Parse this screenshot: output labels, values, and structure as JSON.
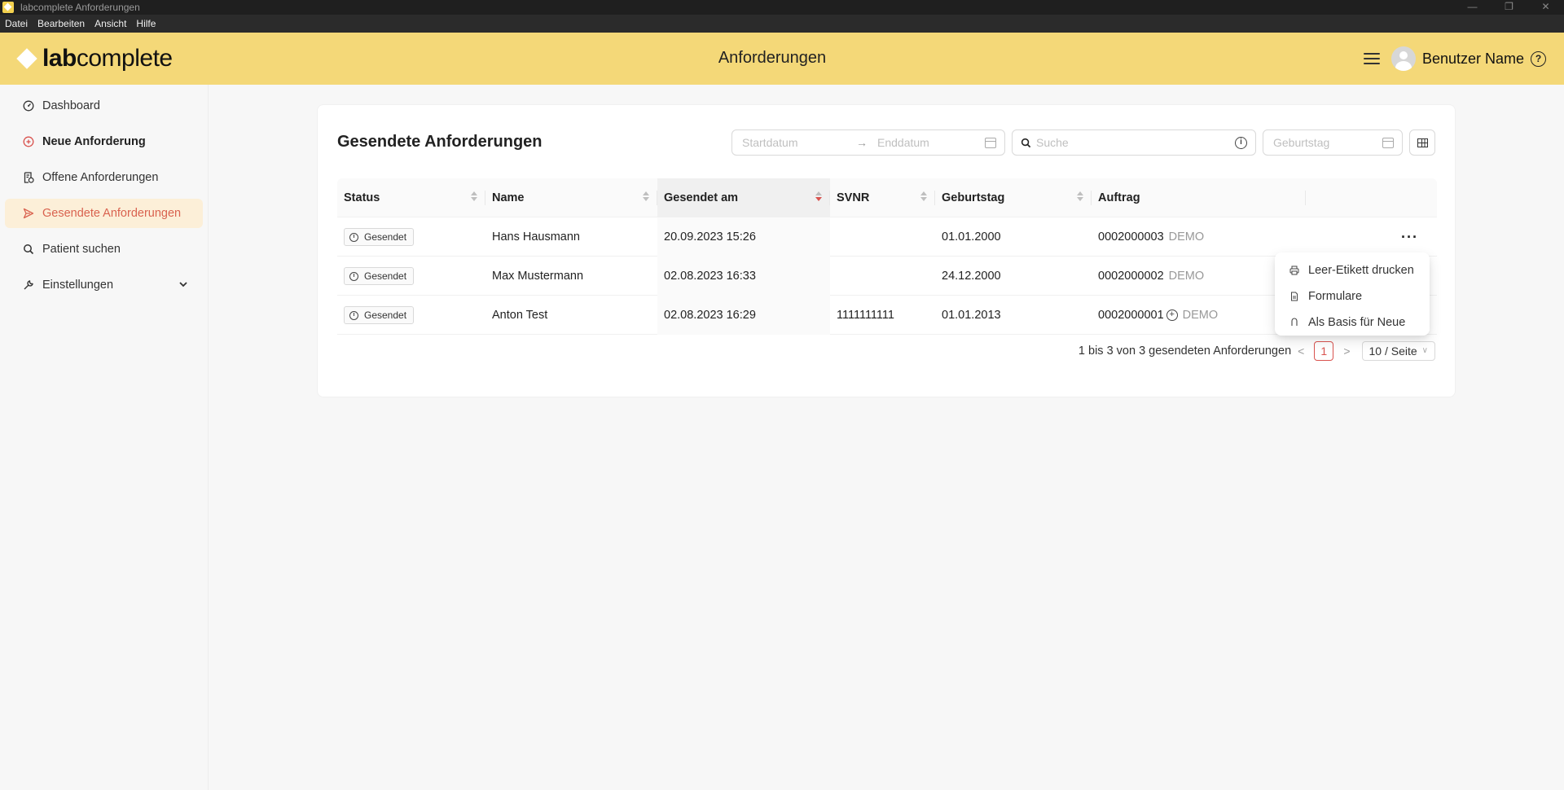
{
  "window": {
    "title": "labcomplete Anforderungen",
    "controls": [
      "—",
      "❐",
      "✕"
    ]
  },
  "menubar": [
    "Datei",
    "Bearbeiten",
    "Ansicht",
    "Hilfe"
  ],
  "header": {
    "logo_bold": "lab",
    "logo_regular": "complete",
    "title": "Anforderungen",
    "user_name": "Benutzer Name",
    "help": "?",
    "accent_color": "#f4d878"
  },
  "sidebar": {
    "items": [
      {
        "label": "Dashboard",
        "icon": "dashboard-icon"
      },
      {
        "label": "Neue Anforderung",
        "icon": "plus-circle-icon"
      },
      {
        "label": "Offene Anforderungen",
        "icon": "document-clock-icon"
      },
      {
        "label": "Gesendete Anforderungen",
        "icon": "send-icon"
      },
      {
        "label": "Patient suchen",
        "icon": "search-icon"
      },
      {
        "label": "Einstellungen",
        "icon": "wrench-icon"
      }
    ],
    "active_color": "#d9624f"
  },
  "card": {
    "title": "Gesendete Anforderungen"
  },
  "filters": {
    "start_placeholder": "Startdatum",
    "end_placeholder": "Enddatum",
    "search_placeholder": "Suche",
    "birthday_placeholder": "Geburtstag"
  },
  "table": {
    "columns": [
      "Status",
      "Name",
      "Gesendet am",
      "SVNR",
      "Geburtstag",
      "Auftrag"
    ],
    "rows": [
      {
        "status": "Gesendet",
        "name": "Hans Hausmann",
        "sent": "20.09.2023 15:26",
        "svnr": "",
        "birthday": "01.01.2000",
        "order": "0002000003",
        "tag": "DEMO"
      },
      {
        "status": "Gesendet",
        "name": "Max Mustermann",
        "sent": "02.08.2023 16:33",
        "svnr": "",
        "birthday": "24.12.2000",
        "order": "0002000002",
        "tag": "DEMO"
      },
      {
        "status": "Gesendet",
        "name": "Anton Test",
        "sent": "02.08.2023 16:29",
        "svnr": "1111111111",
        "birthday": "01.01.2013",
        "order": "0002000001",
        "tag": "DEMO"
      }
    ],
    "more": "···"
  },
  "pagination": {
    "summary": "1 bis 3 von 3 gesendeten Anforderungen",
    "prev": "<",
    "current": "1",
    "next": ">",
    "page_size": "10 / Seite"
  },
  "row_menu": {
    "items": [
      {
        "label": "Leer-Etikett drucken",
        "icon": "printer-icon"
      },
      {
        "label": "Formulare",
        "icon": "file-icon"
      },
      {
        "label": "Als Basis für Neue",
        "icon": "copy-icon"
      }
    ]
  }
}
